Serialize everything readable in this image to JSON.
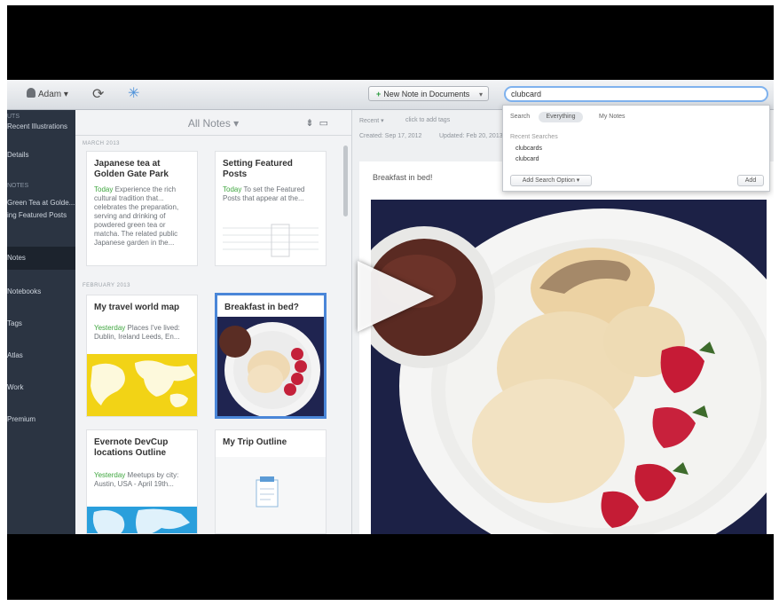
{
  "toolbar": {
    "user_label": "Adam ▾",
    "new_note_label": "New Note in Documents",
    "search_value": "clubcard"
  },
  "sidebar": {
    "items": [
      {
        "label": "UTS"
      },
      {
        "label": "Recent Illustrations"
      },
      {
        "label": "Details"
      },
      {
        "label": "NOTES"
      },
      {
        "label": "Green Tea at Golde..."
      },
      {
        "label": "ing Featured Posts"
      },
      {
        "label": "Notes"
      },
      {
        "label": "Notebooks"
      },
      {
        "label": "Tags"
      },
      {
        "label": "Atlas"
      },
      {
        "label": "Work"
      },
      {
        "label": "Premium"
      }
    ]
  },
  "note_list": {
    "title": "All Notes ▾",
    "sections": [
      "MARCH 2013",
      "FEBRUARY 2013"
    ],
    "cards": [
      {
        "title": "Japanese tea at Golden Gate Park",
        "when": "Today",
        "snippet": "Experience the rich cultural tradition that... celebrates the preparation, serving and drinking of powdered green tea or matcha. The related public Japanese garden in the..."
      },
      {
        "title": "Setting Featured Posts",
        "when": "Today",
        "snippet": "To set the Featured Posts that appear at the..."
      },
      {
        "title": "My travel world map",
        "when": "Yesterday",
        "snippet": "Places I've lived: Dublin, Ireland Leeds, En..."
      },
      {
        "title": "Breakfast in bed?",
        "when": "",
        "snippet": ""
      },
      {
        "title": "Evernote DevCup locations Outline",
        "when": "Yesterday",
        "snippet": "Meetups by city: Austin, USA - April 19th..."
      },
      {
        "title": "My Trip Outline",
        "when": "",
        "snippet": ""
      }
    ]
  },
  "editor": {
    "notebook": "Recent ▾",
    "tags_placeholder": "click to add tags",
    "created": "Created: Sep 17, 2012",
    "updated": "Updated: Feb 20, 2013",
    "note_title": "Breakfast in bed!"
  },
  "search_dropdown": {
    "scope_label": "Search",
    "scope_everything": "Everything",
    "scope_my_notes": "My Notes",
    "recent_header": "Recent Searches",
    "recent": [
      "clubcards",
      "clubcard"
    ],
    "add_option_label": "Add Search Option ▾",
    "add_label": "Add"
  },
  "colors": {
    "sidebar_bg": "#2b3442",
    "accent": "#4a86d8",
    "link_green": "#3fa63f"
  }
}
